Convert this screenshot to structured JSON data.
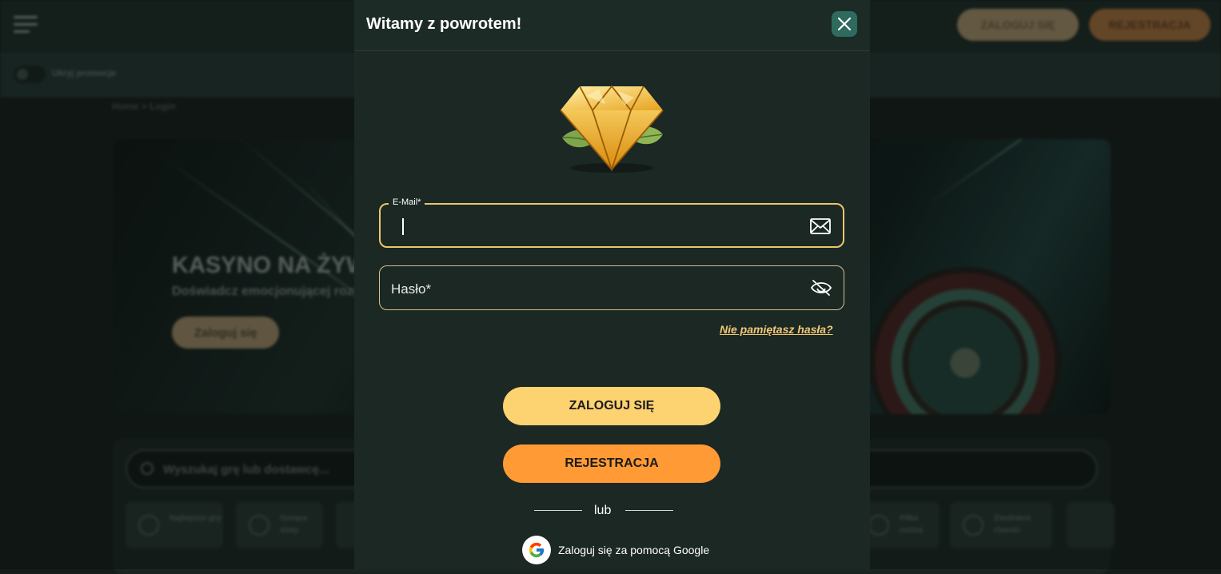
{
  "background": {
    "header": {
      "login_label": "ZALOGUJ SIĘ",
      "register_label": "REJESTRACJA"
    },
    "promo_toggle_label": "Ukryj promocje",
    "breadcrumb": "Home  >  Login",
    "hero": {
      "title": "KASYNO NA ŻYWO",
      "subtitle": "Doświadcz emocjonującej rozgrywki",
      "button_label": "Zaloguj się"
    },
    "search": {
      "placeholder": "Wyszukaj grę lub dostawcę..."
    },
    "categories": [
      {
        "label": "Najlepsze gry",
        "icon": "chart-icon"
      },
      {
        "label": "Gorące sloty",
        "icon": "flame-icon"
      },
      {
        "label": "Piłka nożna",
        "icon": "football-icon"
      },
      {
        "label": "Zwolnieni classic",
        "icon": "trophy-icon"
      }
    ]
  },
  "modal": {
    "title": "Witamy z powrotem!",
    "close_icon": "close-icon",
    "logo_icon": "diamond-icon",
    "email": {
      "label": "E-Mail*",
      "value": "",
      "icon": "envelope-icon"
    },
    "password": {
      "placeholder": "Hasło*",
      "icon": "eye-off-icon"
    },
    "forgot_password": "Nie pamiętasz hasła?",
    "login_button": "ZALOGUJ SIĘ",
    "register_button": "REJESTRACJA",
    "divider_text": "lub",
    "google_button": "Zaloguj się za pomocą Google",
    "colors": {
      "accent_yellow": "#fdd270",
      "accent_orange": "#ff9a35",
      "close_bg": "#2e6a5e",
      "panel_bg": "#1b2824"
    }
  }
}
